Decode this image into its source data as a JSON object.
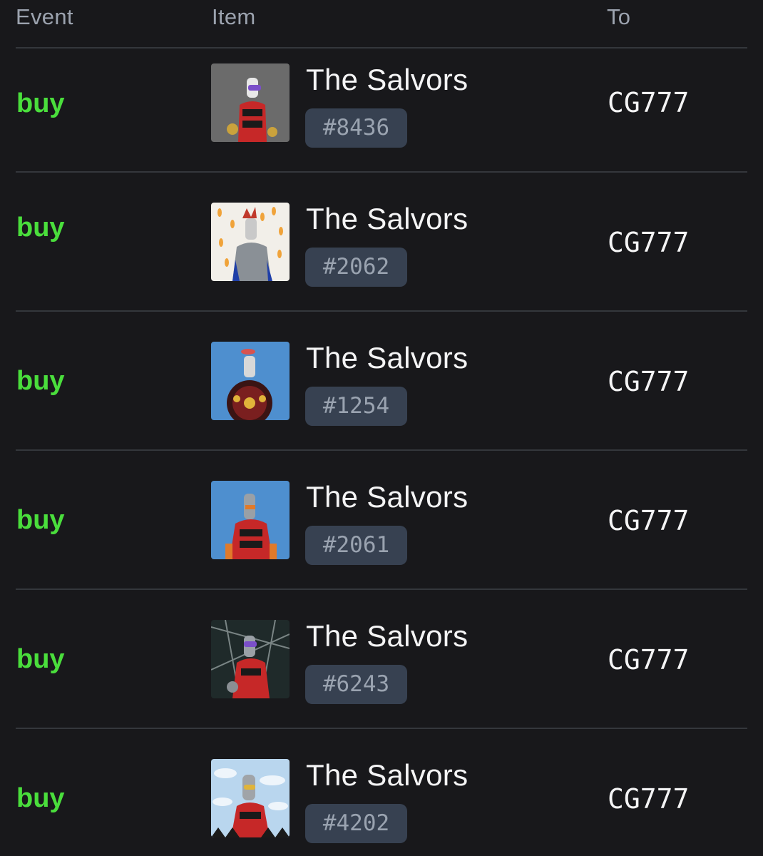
{
  "table": {
    "headers": {
      "event": "Event",
      "item": "Item",
      "to": "To"
    },
    "rows": [
      {
        "event": "buy",
        "name": "The Salvors",
        "token_id": "#8436",
        "to": "CG777",
        "thumb_bg": "#6b6b6b",
        "thumb_icon": "salvor-robot-icon"
      },
      {
        "event": "buy",
        "name": "The Salvors",
        "token_id": "#2062",
        "to": "CG777",
        "thumb_bg": "#f2efe9",
        "thumb_icon": "salvor-robot-icon"
      },
      {
        "event": "buy",
        "name": "The Salvors",
        "token_id": "#1254",
        "to": "CG777",
        "thumb_bg": "#4e8fcf",
        "thumb_icon": "salvor-robot-icon"
      },
      {
        "event": "buy",
        "name": "The Salvors",
        "token_id": "#2061",
        "to": "CG777",
        "thumb_bg": "#4e8fcf",
        "thumb_icon": "salvor-robot-icon"
      },
      {
        "event": "buy",
        "name": "The Salvors",
        "token_id": "#6243",
        "to": "CG777",
        "thumb_bg": "#1f2a2a",
        "thumb_icon": "salvor-robot-icon"
      },
      {
        "event": "buy",
        "name": "The Salvors",
        "token_id": "#4202",
        "to": "CG777",
        "thumb_bg": "#b9d6ee",
        "thumb_icon": "salvor-robot-icon"
      }
    ]
  },
  "colors": {
    "background": "#18181b",
    "event_buy": "#4ade3c",
    "badge_bg": "#374151",
    "divider": "#34373c"
  }
}
